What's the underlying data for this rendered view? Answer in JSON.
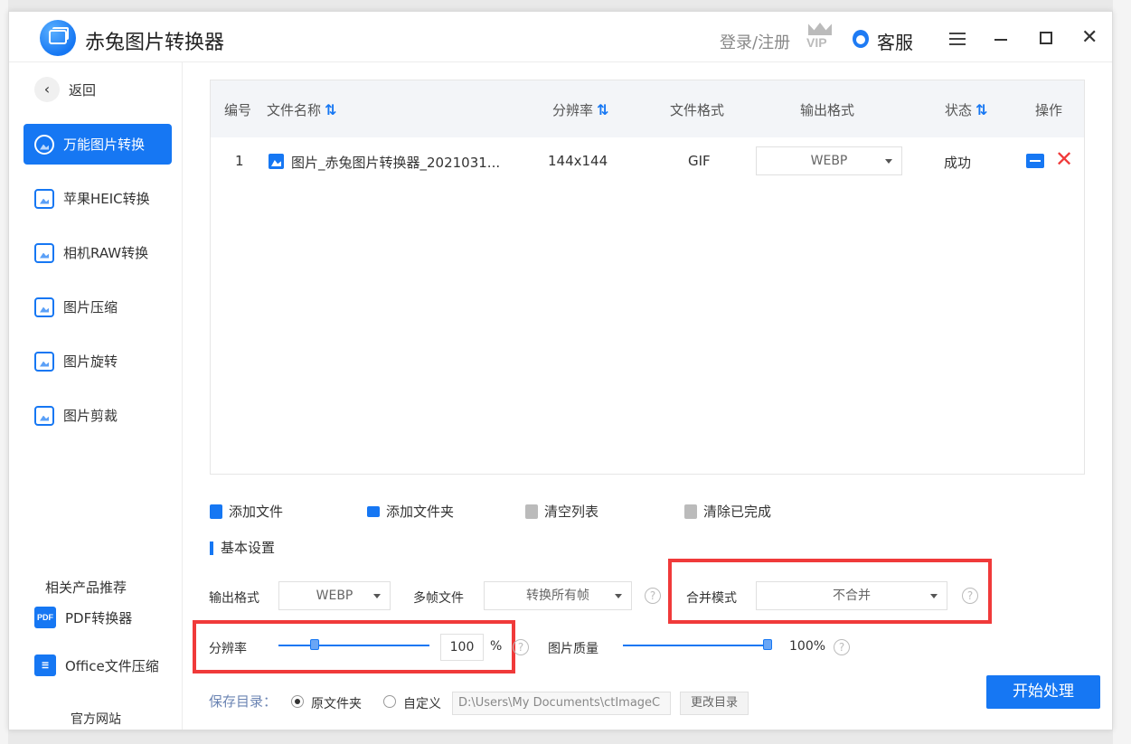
{
  "titlebar": {
    "title": "赤兔图片转换器",
    "login": "登录/注册",
    "vip": "VIP",
    "service": "客服"
  },
  "sidebar": {
    "back": "返回",
    "items": [
      {
        "label": "万能图片转换",
        "active": true
      },
      {
        "label": "苹果HEIC转换"
      },
      {
        "label": "相机RAW转换"
      },
      {
        "label": "图片压缩"
      },
      {
        "label": "图片旋转"
      },
      {
        "label": "图片剪裁"
      }
    ],
    "related_title": "相关产品推荐",
    "products": [
      {
        "label": "PDF转换器",
        "icon_text": "PDF"
      },
      {
        "label": "Office文件压缩"
      }
    ],
    "website": "官方网站"
  },
  "table": {
    "headers": {
      "no": "编号",
      "name": "文件名称",
      "resolution": "分辨率",
      "format": "文件格式",
      "output": "输出格式",
      "status": "状态",
      "action": "操作"
    },
    "rows": [
      {
        "no": "1",
        "name": "图片_赤兔图片转换器_2021031...",
        "resolution": "144x144",
        "format": "GIF",
        "output": "WEBP",
        "status": "成功"
      }
    ]
  },
  "toolbar": {
    "add_file": "添加文件",
    "add_folder": "添加文件夹",
    "clear_list": "清空列表",
    "clear_done": "清除已完成"
  },
  "settings": {
    "title": "基本设置",
    "output_format_label": "输出格式",
    "output_format_value": "WEBP",
    "multiframe_label": "多帧文件",
    "multiframe_value": "转换所有帧",
    "merge_label": "合并模式",
    "merge_value": "不合并",
    "resolution_label": "分辨率",
    "resolution_value": "100",
    "resolution_unit": "%",
    "resolution_fraction": 0.22,
    "quality_label": "图片质量",
    "quality_value": "100%",
    "quality_fraction": 1.0,
    "save_label": "保存目录：",
    "save_original": "原文件夹",
    "save_custom": "自定义",
    "save_path": "D:\\Users\\My Documents\\ctImageC",
    "change_dir": "更改目录",
    "start": "开始处理"
  },
  "colors": {
    "accent": "#1677f3",
    "highlight": "#f03a3a"
  }
}
